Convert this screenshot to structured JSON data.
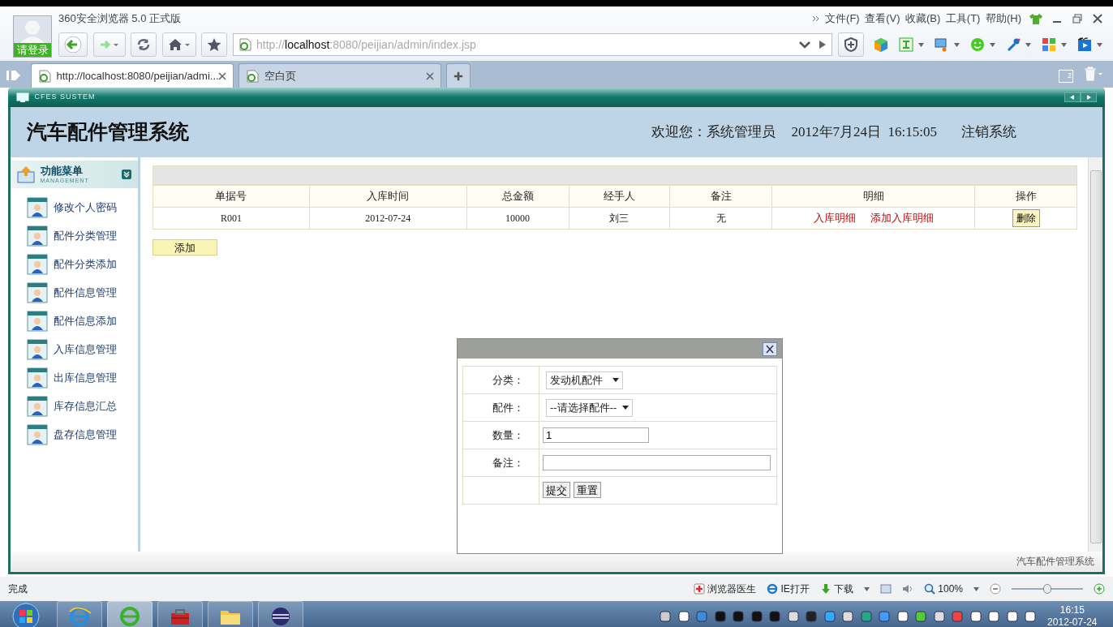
{
  "browser": {
    "title": "360安全浏览器 5.0 正式版",
    "login_label": "请登录",
    "url_parts": [
      {
        "text": "http://",
        "kind": "dim"
      },
      {
        "text": "localhost",
        "kind": "host"
      },
      {
        "text": ":8080/peijian/admin/index.jsp",
        "kind": "dim"
      }
    ],
    "menu": [
      "文件(F)",
      "查看(V)",
      "收藏(B)",
      "工具(T)",
      "帮助(H)"
    ],
    "tabs": [
      {
        "label": "http://localhost:8080/peijian/admi...",
        "selected": true
      },
      {
        "label": "空白页",
        "selected": false
      }
    ],
    "tab_count": "2"
  },
  "app": {
    "frame_label": "CFES SUSTEM",
    "title": "汽车配件管理系统",
    "welcome": "欢迎您：系统管理员",
    "datetime": "2012年7月24日  16:15:05",
    "logout": "注销系统"
  },
  "sidebar": {
    "title": "功能菜单",
    "subtitle": "MANAGEMENT",
    "items": [
      "修改个人密码",
      "配件分类管理",
      "配件分类添加",
      "配件信息管理",
      "配件信息添加",
      "入库信息管理",
      "出库信息管理",
      "库存信息汇总",
      "盘存信息管理"
    ]
  },
  "table": {
    "columns": [
      "单据号",
      "入库时间",
      "总金额",
      "经手人",
      "备注",
      "明细",
      "操作"
    ],
    "rows": [
      {
        "cells": [
          "R001",
          "2012-07-24",
          "10000",
          "刘三",
          "无"
        ],
        "links": [
          "入库明细",
          "添加入库明细"
        ],
        "action": "删除"
      }
    ]
  },
  "add_button": "添加",
  "dialog": {
    "fields": [
      {
        "label": "分类：",
        "kind": "select",
        "value": "发动机配件"
      },
      {
        "label": "配件：",
        "kind": "select",
        "value": "--请选择配件--"
      },
      {
        "label": "数量：",
        "kind": "input",
        "value": "1"
      },
      {
        "label": "备注：",
        "kind": "input"
      }
    ],
    "buttons": [
      "提交",
      "重置"
    ]
  },
  "footer": "汽车配件管理系统",
  "status_bar": {
    "text": "完成",
    "items": [
      "浏览器医生",
      "IE打开",
      "下载"
    ],
    "zoom": "100%",
    "zoom_slider": {
      "level": 0.5
    }
  },
  "taskbar": {
    "apps": [
      {
        "kind": "ie",
        "selected": false
      },
      {
        "kind": "browser360",
        "selected": true
      },
      {
        "kind": "toolbox",
        "selected": false
      },
      {
        "kind": "explorer",
        "selected": false
      },
      {
        "kind": "eclipse",
        "selected": false
      }
    ],
    "time": "16:15",
    "date": "2012-07-24"
  }
}
